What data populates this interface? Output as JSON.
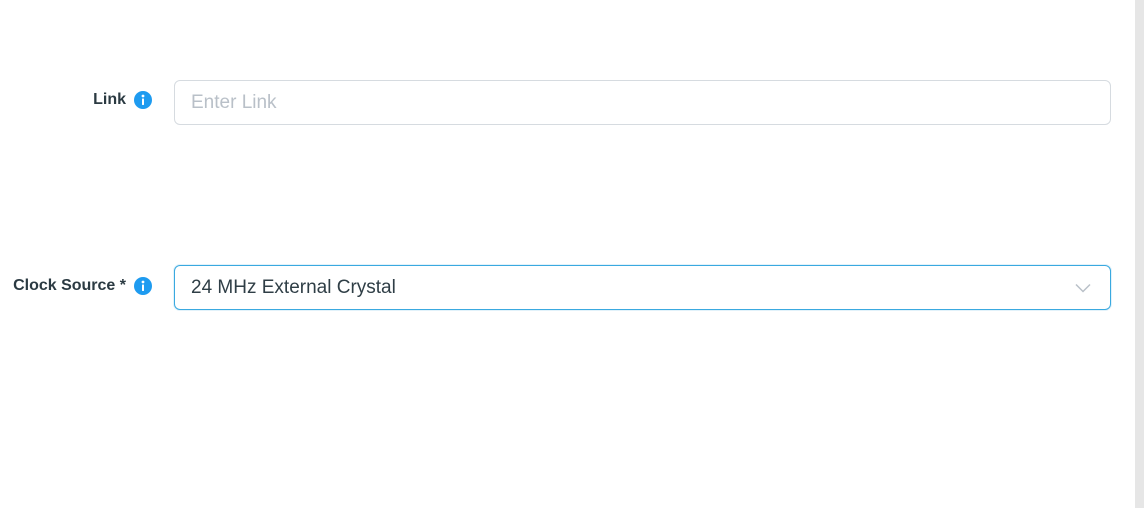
{
  "form": {
    "link": {
      "label": "Link",
      "placeholder": "Enter Link",
      "value": "",
      "info_icon": "info-icon"
    },
    "clock_source": {
      "label": "Clock Source *",
      "value": "24 MHz External Crystal",
      "info_icon": "info-icon",
      "dropdown_icon": "chevron-down-icon"
    }
  },
  "colors": {
    "accent": "#1e9bf0",
    "focus_border": "#3aa9e0",
    "label_text": "#2b3a42",
    "input_border": "#d6dbe0",
    "placeholder": "#b9c0c8"
  }
}
